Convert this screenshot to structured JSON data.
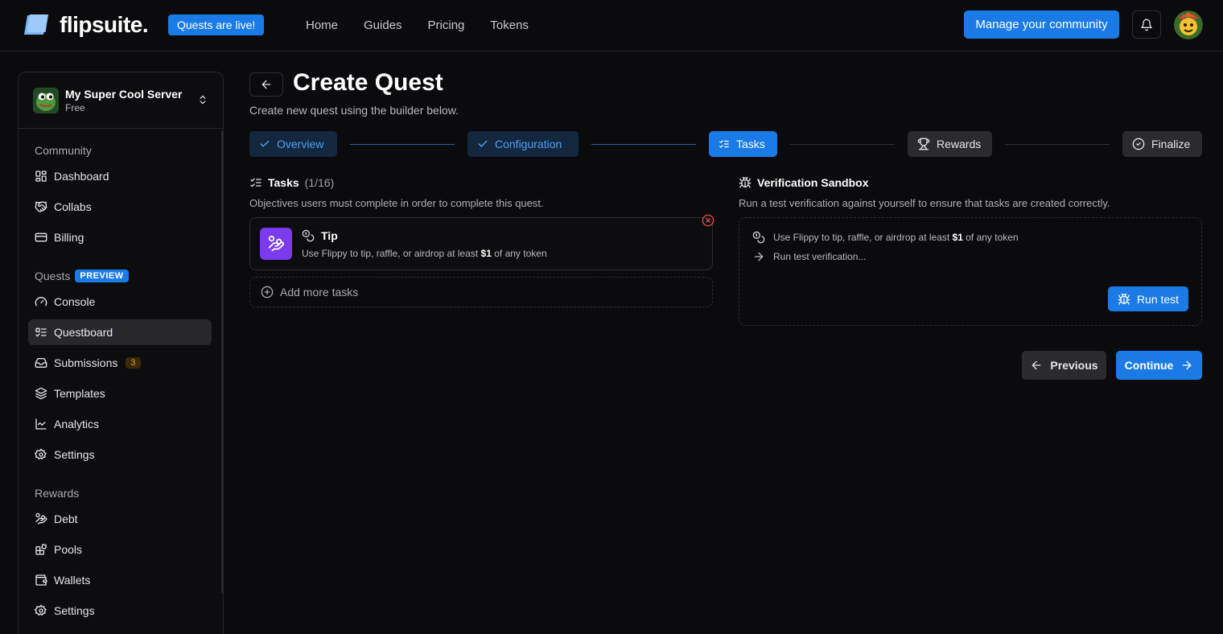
{
  "header": {
    "brand": "flipsuite.",
    "badge": "Quests are live!",
    "nav": [
      "Home",
      "Guides",
      "Pricing",
      "Tokens"
    ],
    "manage_label": "Manage your community"
  },
  "sidebar": {
    "server_name": "My Super Cool Server",
    "server_plan": "Free",
    "community_title": "Community",
    "community_items": [
      "Dashboard",
      "Collabs",
      "Billing"
    ],
    "quests_title": "Quests",
    "quests_badge": "PREVIEW",
    "quests_items": [
      "Console",
      "Questboard",
      "Submissions",
      "Templates",
      "Analytics",
      "Settings"
    ],
    "submissions_count": "3",
    "active_item": "Questboard",
    "rewards_title": "Rewards",
    "rewards_items": [
      "Debt",
      "Pools",
      "Wallets",
      "Settings"
    ]
  },
  "main": {
    "title": "Create Quest",
    "subtitle": "Create new quest using the builder below.",
    "steps": [
      {
        "label": "Overview",
        "state": "done"
      },
      {
        "label": "Configuration",
        "state": "done"
      },
      {
        "label": "Tasks",
        "state": "current"
      },
      {
        "label": "Rewards",
        "state": "pending"
      },
      {
        "label": "Finalize",
        "state": "pending"
      }
    ],
    "tasks": {
      "title": "Tasks",
      "count": "(1/16)",
      "description": "Objectives users must complete in order to complete this quest.",
      "items": [
        {
          "title": "Tip",
          "desc_before": "Use Flippy to tip, raffle, or airdrop at least ",
          "desc_amount": "$1",
          "desc_after": " of any token"
        }
      ],
      "add_label": "Add more tasks"
    },
    "sandbox": {
      "title": "Verification Sandbox",
      "description": "Run a test verification against yourself to ensure that tasks are created correctly.",
      "line1_before": "Use Flippy to tip, raffle, or airdrop at least ",
      "line1_amount": "$1",
      "line1_after": " of any token",
      "line2": "Run test verification...",
      "run_label": "Run test"
    },
    "previous_label": "Previous",
    "continue_label": "Continue"
  },
  "colors": {
    "accent": "#1b7be6",
    "background": "#0b0b0e",
    "task_icon_bg": "#7c3aed",
    "remove_red": "#e5484d",
    "badge_amber": "#e0a820"
  }
}
